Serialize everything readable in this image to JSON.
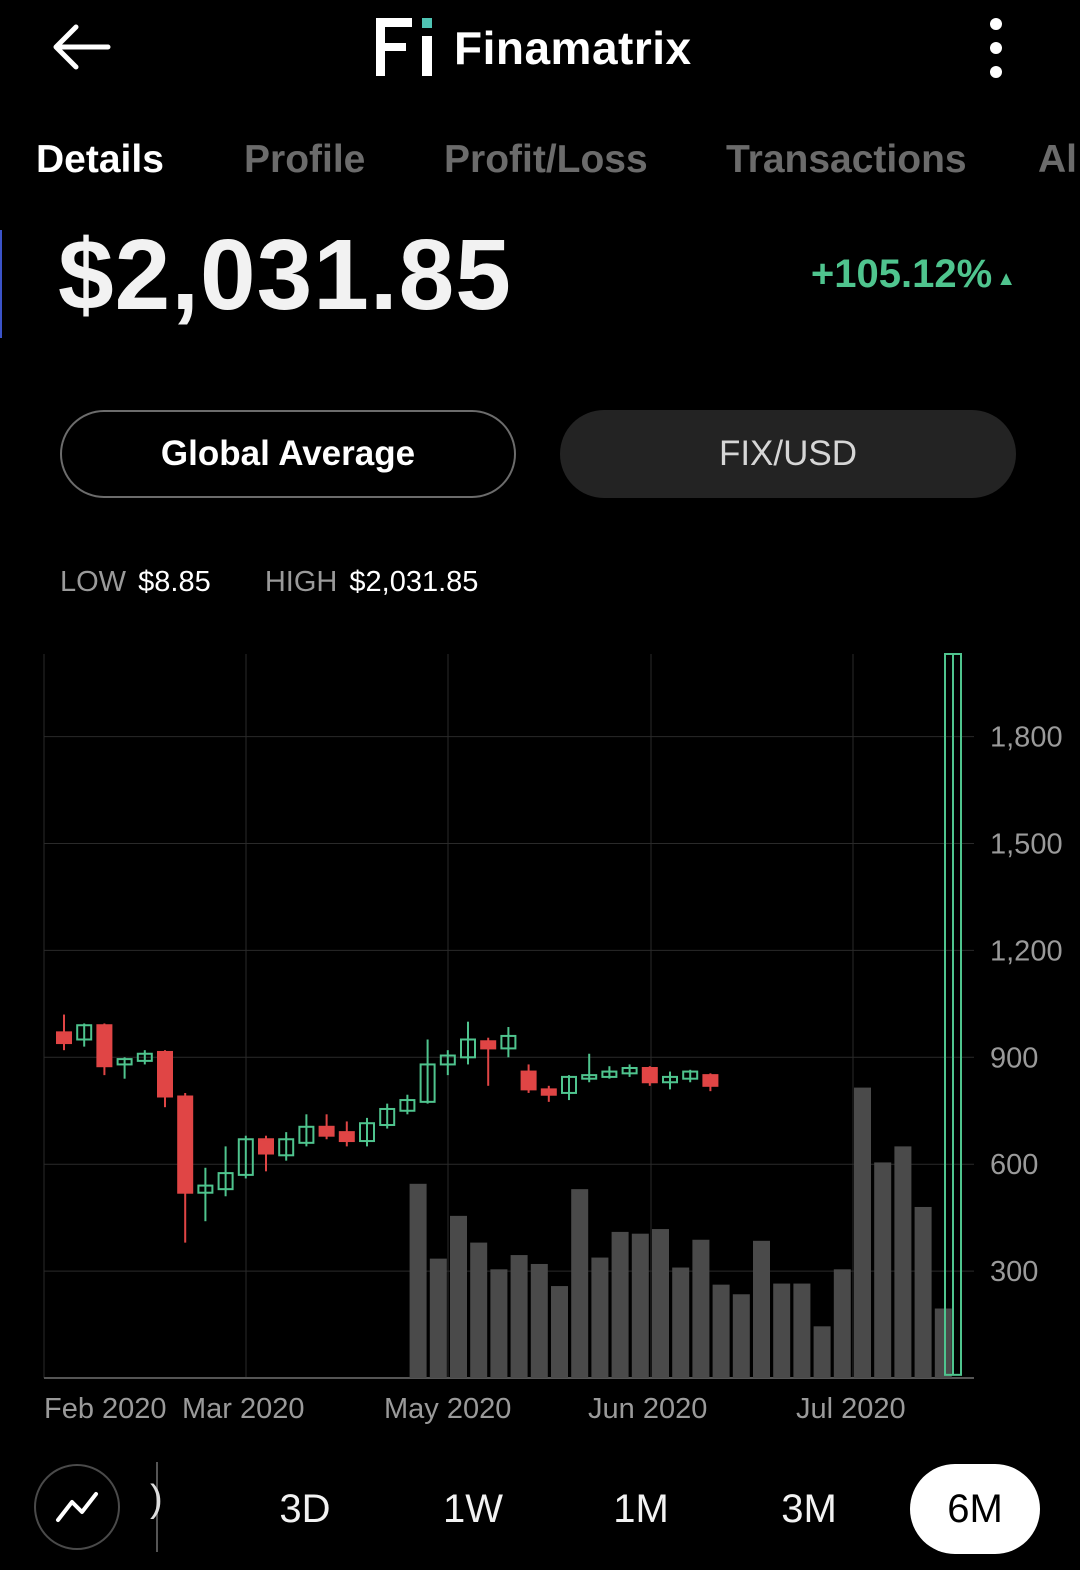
{
  "header": {
    "app_name": "Finamatrix",
    "logo_mark": "Fi",
    "back_icon": "arrow-left-icon",
    "menu_icon": "more-vertical-icon"
  },
  "tabs": [
    {
      "label": "Details",
      "active": true
    },
    {
      "label": "Profile",
      "active": false
    },
    {
      "label": "Profit/Loss",
      "active": false
    },
    {
      "label": "Transactions",
      "active": false
    },
    {
      "label": "Al",
      "active": false
    }
  ],
  "price": {
    "value": "$2,031.85",
    "change": "+105.12%",
    "change_icon": "▲",
    "change_color": "#4fc48e"
  },
  "selectors": {
    "source_label": "Global Average",
    "pair_label": "FIX/USD"
  },
  "range": {
    "low_label": "LOW",
    "low_value": "$8.85",
    "high_label": "HIGH",
    "high_value": "$2,031.85"
  },
  "chart_data": {
    "type": "candlestick",
    "x_tick_labels": [
      "Feb 2020",
      "Mar 2020",
      "May 2020",
      "Jun 2020",
      "Jul 2020"
    ],
    "y_ticks": [
      300,
      600,
      900,
      1200,
      1500,
      1800
    ],
    "y_tick_labels": [
      "300",
      "600",
      "900",
      "1,200",
      "1,500",
      "1,800"
    ],
    "ylim": [
      0,
      2031.85
    ],
    "up_color": "#4fc48e",
    "down_color": "#e04545",
    "volume_color": "#4a4a4a",
    "candles": [
      {
        "o": 970,
        "c": 940,
        "h": 1020,
        "l": 920
      },
      {
        "o": 950,
        "c": 990,
        "h": 995,
        "l": 930
      },
      {
        "o": 990,
        "c": 875,
        "h": 995,
        "l": 850
      },
      {
        "o": 880,
        "c": 895,
        "h": 900,
        "l": 840
      },
      {
        "o": 890,
        "c": 910,
        "h": 920,
        "l": 880
      },
      {
        "o": 915,
        "c": 790,
        "h": 920,
        "l": 760
      },
      {
        "o": 790,
        "c": 520,
        "h": 800,
        "l": 380
      },
      {
        "o": 520,
        "c": 540,
        "h": 590,
        "l": 440
      },
      {
        "o": 530,
        "c": 575,
        "h": 650,
        "l": 510
      },
      {
        "o": 570,
        "c": 670,
        "h": 680,
        "l": 560
      },
      {
        "o": 670,
        "c": 630,
        "h": 680,
        "l": 580
      },
      {
        "o": 625,
        "c": 670,
        "h": 690,
        "l": 610
      },
      {
        "o": 660,
        "c": 705,
        "h": 740,
        "l": 650
      },
      {
        "o": 705,
        "c": 680,
        "h": 740,
        "l": 670
      },
      {
        "o": 690,
        "c": 665,
        "h": 720,
        "l": 650
      },
      {
        "o": 665,
        "c": 715,
        "h": 730,
        "l": 650
      },
      {
        "o": 710,
        "c": 755,
        "h": 770,
        "l": 700
      },
      {
        "o": 750,
        "c": 780,
        "h": 795,
        "l": 740
      },
      {
        "o": 775,
        "c": 880,
        "h": 950,
        "l": 770
      },
      {
        "o": 880,
        "c": 905,
        "h": 920,
        "l": 850
      },
      {
        "o": 900,
        "c": 950,
        "h": 1000,
        "l": 880
      },
      {
        "o": 945,
        "c": 925,
        "h": 955,
        "l": 820
      },
      {
        "o": 925,
        "c": 960,
        "h": 985,
        "l": 900
      },
      {
        "o": 860,
        "c": 810,
        "h": 880,
        "l": 800
      },
      {
        "o": 810,
        "c": 795,
        "h": 820,
        "l": 775
      },
      {
        "o": 800,
        "c": 845,
        "h": 850,
        "l": 780
      },
      {
        "o": 840,
        "c": 850,
        "h": 910,
        "l": 830
      },
      {
        "o": 845,
        "c": 860,
        "h": 875,
        "l": 840
      },
      {
        "o": 855,
        "c": 870,
        "h": 880,
        "l": 845
      },
      {
        "o": 870,
        "c": 830,
        "h": 875,
        "l": 820
      },
      {
        "o": 830,
        "c": 845,
        "h": 860,
        "l": 810
      },
      {
        "o": 840,
        "c": 860,
        "h": 865,
        "l": 830
      },
      {
        "o": 850,
        "c": 820,
        "h": 855,
        "l": 805
      },
      {
        "o": 8.85,
        "c": 2031.85,
        "h": 2031.85,
        "l": 8.85
      }
    ],
    "volume": [
      0,
      0,
      0,
      0,
      0,
      0,
      0,
      0,
      0,
      0,
      0,
      0,
      0,
      0,
      0,
      0,
      0,
      0,
      545,
      335,
      455,
      380,
      305,
      345,
      320,
      258,
      530,
      338,
      410,
      405,
      418,
      310,
      388,
      262,
      235,
      385,
      265,
      265,
      145,
      305,
      815,
      605,
      650,
      480,
      195
    ]
  },
  "timeframes": {
    "chart_type_icon": "line-chart-icon",
    "clipped_label": ")",
    "options": [
      {
        "label": "3D",
        "active": false
      },
      {
        "label": "1W",
        "active": false
      },
      {
        "label": "1M",
        "active": false
      },
      {
        "label": "3M",
        "active": false
      },
      {
        "label": "6M",
        "active": true
      }
    ]
  }
}
